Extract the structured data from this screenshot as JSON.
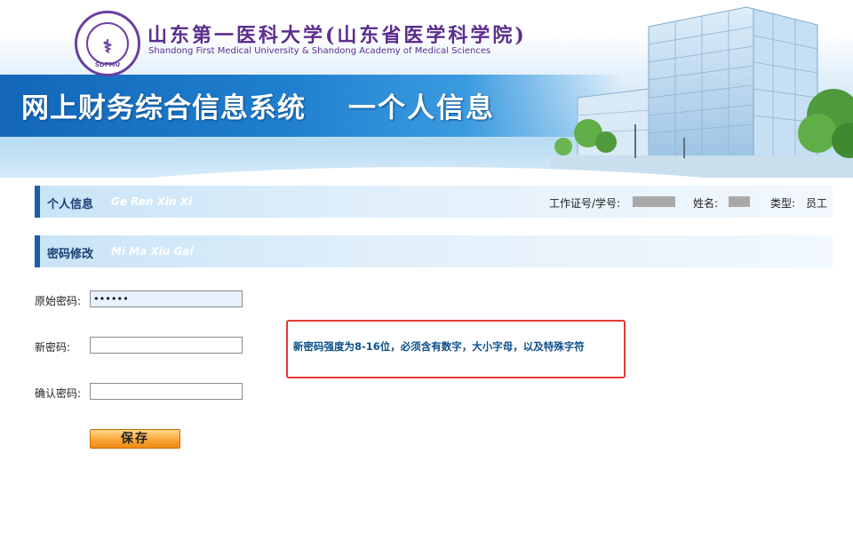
{
  "header": {
    "logo_abbr": "SDFMU",
    "university_cn": "山东第一医科大学(山东省医学科学院)",
    "university_en": "Shandong First Medical University & Shandong Academy of Medical Sciences",
    "system_title": "网上财务综合信息系统",
    "page_title": "一个人信息"
  },
  "personal_info": {
    "title": "个人信息",
    "pinyin": "Ge Ren Xin Xi",
    "id_label": "工作证号/学号:",
    "name_label": "姓名:",
    "type_label": "类型:",
    "type_value": "员工"
  },
  "password_change": {
    "title": "密码修改",
    "pinyin": "Mi Ma Xiu Gai",
    "old_label": "原始密码:",
    "old_value": "••••••",
    "new_label": "新密码:",
    "new_value": "",
    "confirm_label": "确认密码:",
    "confirm_value": "",
    "notice": "新密码强度为8-16位，必须含有数字，大小字母，以及特殊字符",
    "save_label": "保存"
  },
  "colors": {
    "brand_purple": "#5b2e8f",
    "brand_blue": "#1b5ea8",
    "notice_border": "#e53935",
    "save_button": "#f9a63a"
  }
}
